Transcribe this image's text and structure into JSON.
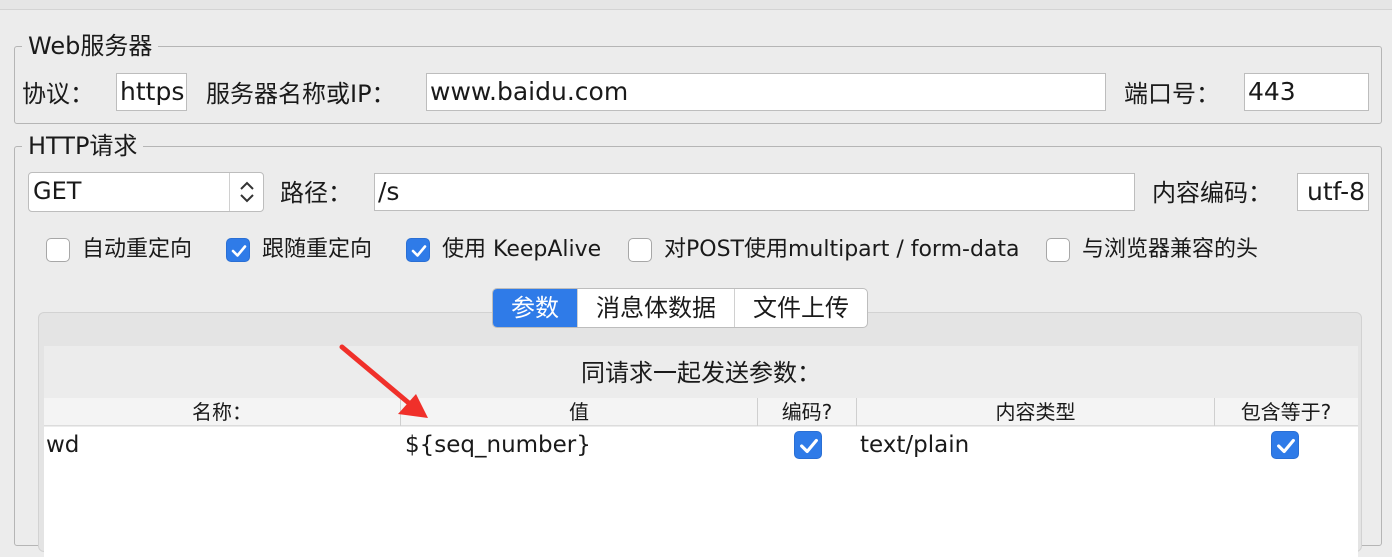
{
  "web_server": {
    "title": "Web服务器",
    "protocol_label": "协议：",
    "protocol_value": "https",
    "server_label": "服务器名称或IP：",
    "server_value": "www.baidu.com",
    "port_label": "端口号：",
    "port_value": "443"
  },
  "http_request": {
    "title": "HTTP请求",
    "method_value": "GET",
    "path_label": "路径：",
    "path_value": "/s",
    "encoding_label": "内容编码：",
    "encoding_value": "utf-8",
    "options": [
      {
        "label": "自动重定向",
        "checked": false
      },
      {
        "label": "跟随重定向",
        "checked": true
      },
      {
        "label": "使用 KeepAlive",
        "checked": true
      },
      {
        "label": "对POST使用multipart / form-data",
        "checked": false
      },
      {
        "label": "与浏览器兼容的头",
        "checked": false
      }
    ]
  },
  "tabs": [
    "参数",
    "消息体数据",
    "文件上传"
  ],
  "params_table": {
    "caption": "同请求一起发送参数：",
    "columns": [
      "名称：",
      "值",
      "编码?",
      "内容类型",
      "包含等于?"
    ],
    "rows": [
      {
        "name": "wd",
        "value": "${seq_number}",
        "encode": true,
        "content_type": "text/plain",
        "include_equals": true
      }
    ]
  },
  "colors": {
    "accent": "#2f7be8",
    "arrow": "#f0302a"
  }
}
